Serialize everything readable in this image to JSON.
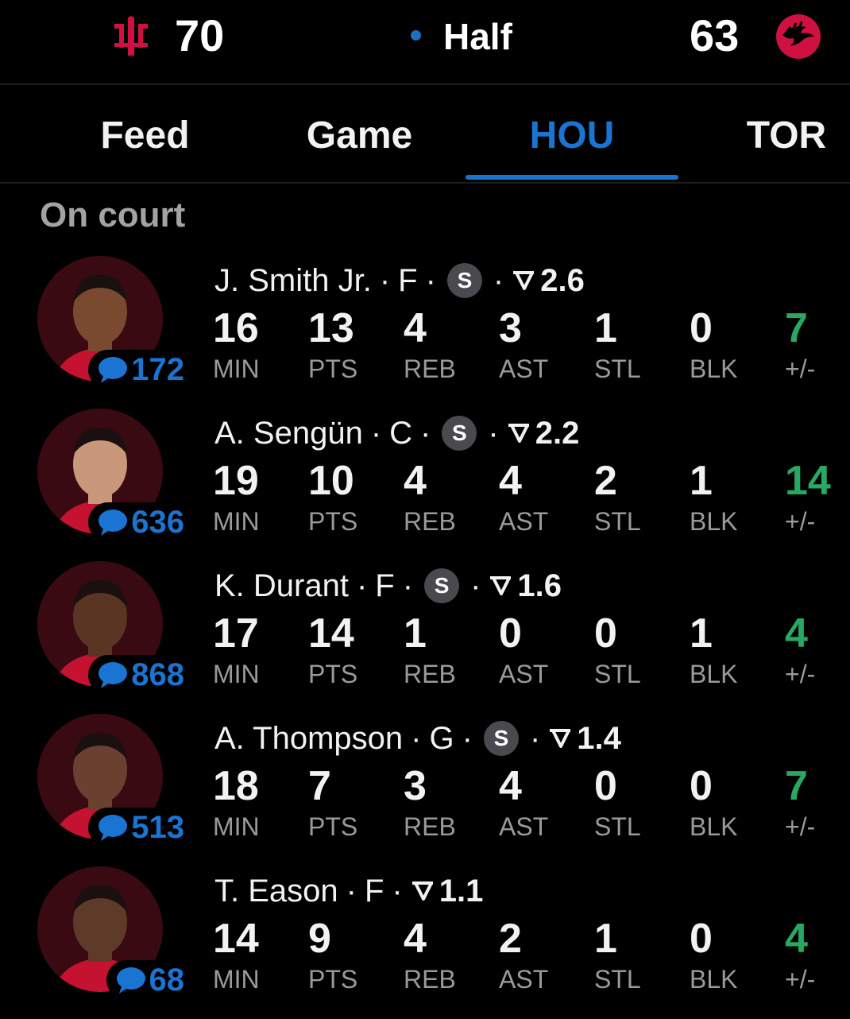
{
  "scoreboard": {
    "home_score": "70",
    "away_score": "63",
    "status": "Half",
    "home_logo_icon": "rockets-logo-icon",
    "away_logo_icon": "raptors-logo-icon",
    "status_dot_color": "#1e6fbf",
    "home_color": "#ce1141",
    "away_color": "#ce1141"
  },
  "tabs": [
    {
      "label": "Feed",
      "active": false
    },
    {
      "label": "Game",
      "active": false
    },
    {
      "label": "HOU",
      "active": true
    },
    {
      "label": "TOR",
      "active": false
    }
  ],
  "section_title": "On court",
  "stat_labels": [
    "MIN",
    "PTS",
    "REB",
    "AST",
    "STL",
    "BLK",
    "+/-"
  ],
  "colors": {
    "accent": "#1a74d2",
    "positive": "#28a860",
    "muted": "#9a9a9a"
  },
  "players": [
    {
      "name": "J. Smith Jr.",
      "pos": "F",
      "starter": "S",
      "rating": "2.6",
      "comments": "172",
      "stats": [
        "16",
        "13",
        "4",
        "3",
        "1",
        "0",
        "7"
      ]
    },
    {
      "name": "A. Sengün",
      "pos": "C",
      "starter": "S",
      "rating": "2.2",
      "comments": "636",
      "stats": [
        "19",
        "10",
        "4",
        "4",
        "2",
        "1",
        "14"
      ]
    },
    {
      "name": "K. Durant",
      "pos": "F",
      "starter": "S",
      "rating": "1.6",
      "comments": "868",
      "stats": [
        "17",
        "14",
        "1",
        "0",
        "0",
        "1",
        "4"
      ]
    },
    {
      "name": "A. Thompson",
      "pos": "G",
      "starter": "S",
      "rating": "1.4",
      "comments": "513",
      "stats": [
        "18",
        "7",
        "3",
        "4",
        "0",
        "0",
        "7"
      ]
    },
    {
      "name": "T. Eason",
      "pos": "F",
      "starter": "",
      "rating": "1.1",
      "comments": "68",
      "stats": [
        "14",
        "9",
        "4",
        "2",
        "1",
        "0",
        "4"
      ]
    }
  ]
}
